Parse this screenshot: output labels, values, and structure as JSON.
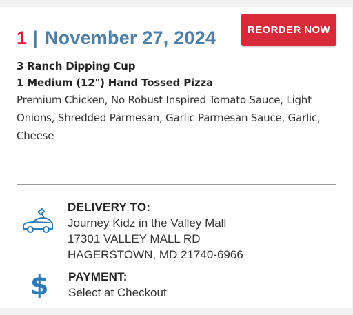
{
  "order": {
    "number": "1",
    "separator": "|",
    "date": "November 27, 2024"
  },
  "reorder_button": {
    "label": "REORDER NOW"
  },
  "items": [
    {
      "name": "3 Ranch Dipping Cup"
    },
    {
      "name": "1 Medium (12\") Hand Tossed Pizza",
      "description_lines": [
        "Premium Chicken, No Robust Inspired Tomato Sauce, Light",
        "Onions, Shredded Parmesan, Garlic Parmesan Sauce, Garlic,",
        "Cheese"
      ]
    }
  ],
  "delivery": {
    "title": "DELIVERY TO:",
    "lines": [
      "Journey Kidz in the Valley Mall",
      "17301 VALLEY MALL RD",
      "HAGERSTOWN, MD 21740-6966"
    ],
    "icon": "delivery-car-icon"
  },
  "payment": {
    "title": "PAYMENT:",
    "value": "Select at Checkout",
    "icon": "dollar-sign-icon",
    "icon_glyph": "$"
  },
  "colors": {
    "accent_red": "#e31837",
    "button_red": "#d92a3a",
    "blue": "#4f7fa6",
    "icon_blue": "#2c7bb6"
  }
}
